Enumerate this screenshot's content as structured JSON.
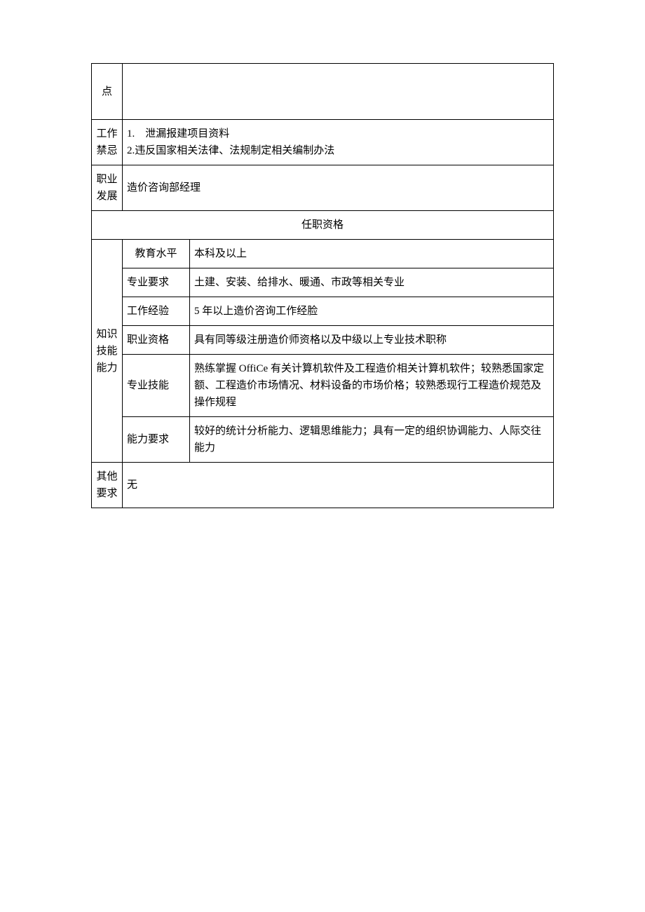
{
  "rows": {
    "point": "点",
    "work_taboo": {
      "label": "工作禁忌",
      "content_line1": "1.　泄漏报建项目资料",
      "content_line2": "2.违反国家相关法律、法规制定相关编制办法"
    },
    "career_dev": {
      "label": "职业发展",
      "content": "造价咨询部经理"
    }
  },
  "section_header": "任职资格",
  "knowledge_skills": {
    "label": "知识技能能力",
    "items": {
      "education": {
        "label": "教育水平",
        "value": "本科及以上"
      },
      "major": {
        "label": "专业要求",
        "value": "土建、安装、给排水、暖通、市政等相关专业"
      },
      "experience": {
        "label": "工作经验",
        "value": "5 年以上造价咨询工作经脸"
      },
      "qualification": {
        "label": "职业资格",
        "value": "具有同等级注册造价师资格以及中级以上专业技术职称"
      },
      "skills": {
        "label": "专业技能",
        "value": "熟练掌握 OffiCe 有关计算机软件及工程造价相关计算机软件；较熟悉国家定额、工程造价市场情况、材料设备的市场价格；较熟悉现行工程造价规范及操作规程"
      },
      "ability": {
        "label": "能力要求",
        "value": "较好的统计分析能力、逻辑思维能力；具有一定的组织协调能力、人际交往能力"
      }
    }
  },
  "other": {
    "label": "其他要求",
    "value": "无"
  }
}
